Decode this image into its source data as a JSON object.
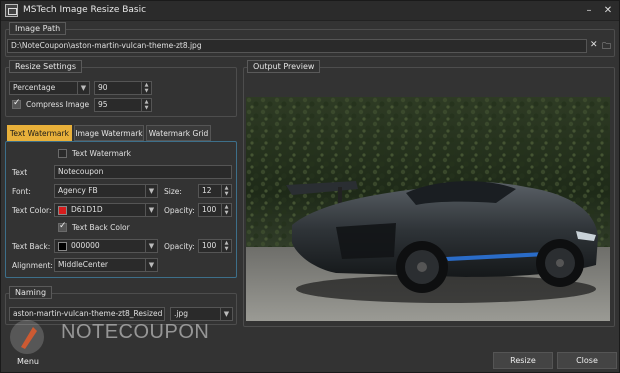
{
  "window": {
    "title": "MSTech Image Resize Basic",
    "minimize_glyph": "–",
    "close_glyph": "✕"
  },
  "image_path": {
    "legend": "Image Path",
    "value": "D:\\NoteCoupon\\aston-martin-vulcan-theme-zt8.jpg",
    "clear_glyph": "✕",
    "browse_glyph": "🗀"
  },
  "resize": {
    "legend": "Resize Settings",
    "mode": "Percentage",
    "value": "90",
    "compress_label": "Compress Image",
    "compress_checked": true,
    "quality": "95"
  },
  "tabs": [
    {
      "label": "Text Watermark",
      "active": true
    },
    {
      "label": "Image Watermark",
      "active": false
    },
    {
      "label": "Watermark Grid",
      "active": false
    }
  ],
  "watermark": {
    "enable_label": "Text Watermark",
    "text_label": "Text",
    "text_value": "Notecoupon",
    "font_label": "Font:",
    "font_value": "Agency FB",
    "size_label": "Size:",
    "size_value": "12",
    "color_label": "Text Color:",
    "color_value": "D61D1D",
    "color_hex": "#d61d1d",
    "opacity_label": "Opacity:",
    "opacity_value": "100",
    "back_color_check_label": "Text Back Color",
    "back_label": "Text Back:",
    "back_value": "000000",
    "back_hex": "#000000",
    "back_opacity_label": "Opacity:",
    "back_opacity_value": "100",
    "alignment_label": "Alignment:",
    "alignment_value": "MiddleCenter"
  },
  "naming": {
    "legend": "Naming",
    "filename": "aston-martin-vulcan-theme-zt8_Resized",
    "extension": ".jpg"
  },
  "preview": {
    "legend": "Output Preview"
  },
  "buttons": {
    "menu": "Menu",
    "resize": "Resize",
    "close": "Close"
  },
  "watermark_overlay": {
    "text": "NOTECOUPON"
  }
}
